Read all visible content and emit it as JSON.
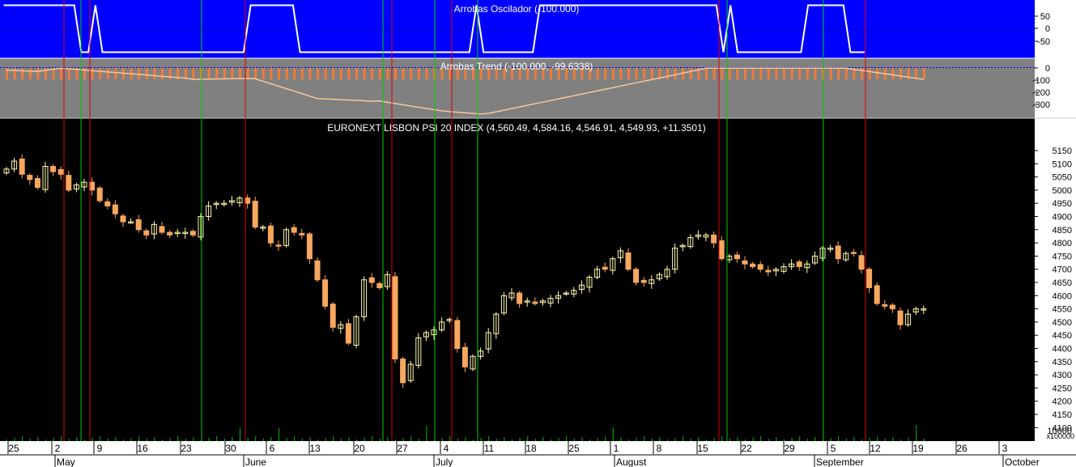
{
  "colors": {
    "osc_bg": "#0000FF",
    "osc_line": "#FFFFFF",
    "trend_bg": "#808080",
    "trend_line": "#F5C79C",
    "trend_bars": "#F07C3A",
    "price_bg": "#000000",
    "candle_down": "#F7A75E",
    "candle_up": "#FFF9A8",
    "volume": "#00C000",
    "buy_line": "#00CC00",
    "sell_line": "#E00000",
    "axis_text": "#000000",
    "axis_bg": "#FFFFFF"
  },
  "panels": {
    "oscillator": {
      "title": "Arrobas Oscilador (-100.000)",
      "ticks": [
        "50",
        "0",
        "-50"
      ]
    },
    "trend": {
      "title": "Arrobas Trend (-100.000, -99.6338)",
      "ticks": [
        "0",
        "-100",
        "-200",
        "-300"
      ]
    },
    "price": {
      "title": "EURONEXT LISBON PSI 20 INDEX (4,560.49, 4,584.16, 4,546.91, 4,549.93, +11.3501)",
      "volume_unit": "x100000",
      "volume_tick": "10000"
    }
  },
  "x_axis": {
    "day_labels": [
      "25",
      "2",
      "9",
      "16",
      "23",
      "30",
      "6",
      "13",
      "20",
      "27",
      "4",
      "11",
      "18",
      "25",
      "1",
      "8",
      "15",
      "22",
      "29",
      "5",
      "12",
      "19",
      "26",
      "3"
    ],
    "month_labels": [
      "May",
      "June",
      "July",
      "August",
      "September",
      "October"
    ]
  },
  "chart_data": {
    "type": "candlestick",
    "title": "EURONEXT LISBON PSI 20 INDEX (4,560.49, 4,584.16, 4,546.91, 4,549.93, +11.3501)",
    "y_range": [
      4080,
      5200
    ],
    "y_ticks": [
      5150,
      5100,
      5050,
      5000,
      4950,
      4900,
      4850,
      4800,
      4750,
      4700,
      4650,
      4600,
      4550,
      4500,
      4450,
      4400,
      4350,
      4300,
      4250,
      4200,
      4150,
      4100
    ],
    "last_bar": {
      "open": 4560.49,
      "high": 4584.16,
      "low": 4546.91,
      "close": 4549.93,
      "change": 11.3501
    },
    "closes": [
      5080,
      5110,
      5060,
      5040,
      5010,
      5090,
      5070,
      5060,
      5000,
      5020,
      5030,
      5000,
      4960,
      4940,
      4910,
      4880,
      4880,
      4850,
      4830,
      4870,
      4840,
      4830,
      4840,
      4840,
      4830,
      4900,
      4940,
      4950,
      4950,
      4960,
      4970,
      4950,
      4860,
      4860,
      4800,
      4790,
      4850,
      4840,
      4830,
      4740,
      4660,
      4560,
      4480,
      4490,
      4420,
      4520,
      4660,
      4650,
      4630,
      4680,
      4360,
      4270,
      4340,
      4440,
      4460,
      4470,
      4500,
      4510,
      4400,
      4330,
      4370,
      4390,
      4460,
      4530,
      4600,
      4610,
      4570,
      4580,
      4570,
      4580,
      4590,
      4600,
      4610,
      4620,
      4640,
      4670,
      4700,
      4700,
      4740,
      4770,
      4700,
      4650,
      4650,
      4660,
      4680,
      4700,
      4780,
      4790,
      4820,
      4830,
      4830,
      4800,
      4740,
      4750,
      4740,
      4720,
      4710,
      4700,
      4690,
      4700,
      4710,
      4720,
      4710,
      4720,
      4750,
      4780,
      4780,
      4740,
      4760,
      4760,
      4700,
      4630,
      4570,
      4560,
      4550,
      4490,
      4530,
      4550,
      4550
    ],
    "osc": [
      100,
      100,
      100,
      100,
      100,
      100,
      100,
      100,
      100,
      100,
      100,
      -100,
      -100,
      100,
      -100,
      -100,
      -100,
      -100,
      -100,
      -100,
      -100,
      -100,
      -100,
      -100,
      -100,
      -100,
      -100,
      -100,
      -100,
      -100,
      -100,
      -100,
      -100,
      -100,
      -100,
      100,
      100,
      100,
      100,
      100,
      100,
      100,
      -100,
      -100,
      -100,
      -100,
      -100,
      -100,
      -100,
      -100,
      -100,
      -100,
      -100,
      -100,
      -100,
      -100,
      -100,
      -100,
      -100,
      -100,
      -100,
      -100,
      -100,
      -100,
      -100,
      -100,
      -100,
      100,
      -100,
      -100,
      -100,
      -100,
      -100,
      -100,
      -100,
      -100,
      100,
      100,
      100,
      100,
      100,
      100,
      100,
      100,
      100,
      100,
      100,
      100,
      100,
      100,
      100,
      100,
      100,
      100,
      100,
      100,
      100,
      100,
      100,
      100,
      100,
      100,
      -100,
      100,
      -100,
      -100,
      -100,
      -100,
      -100,
      -100,
      -100,
      -100,
      -100,
      -100,
      100,
      100,
      100,
      100,
      100,
      100,
      -100,
      -100,
      -100,
      -100,
      -100,
      -100,
      -100,
      -100,
      -100,
      -100,
      -100,
      -100,
      -100
    ],
    "buy_signals": [
      "May 5",
      "May 26",
      "Jun 23",
      "Jul 3",
      "Jul 9",
      "Aug 18",
      "Sep 4"
    ],
    "sell_signals": [
      "May 1",
      "May 6",
      "Jun 2",
      "Jun 25",
      "Jul 7",
      "Aug 17",
      "Sep 10"
    ]
  }
}
